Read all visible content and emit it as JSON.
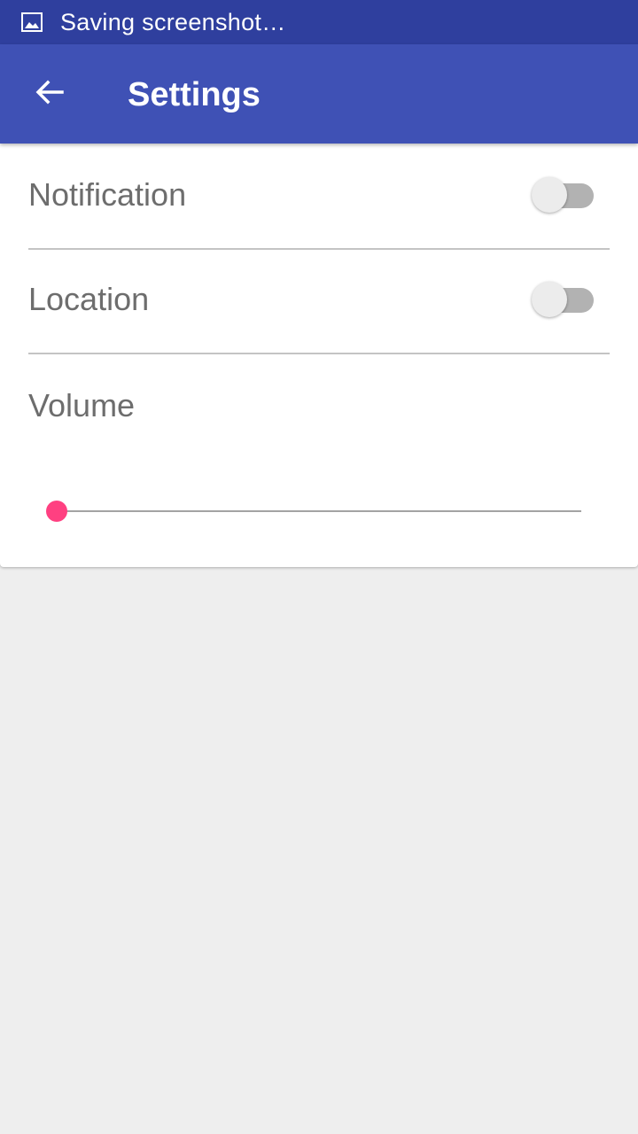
{
  "status_bar": {
    "icon": "image-icon",
    "text": "Saving screenshot…",
    "background": "#2f3f9e"
  },
  "app_bar": {
    "back_icon": "arrow-back-icon",
    "title": "Settings",
    "background": "#3f51b5"
  },
  "settings": {
    "notification": {
      "label": "Notification",
      "enabled": false
    },
    "location": {
      "label": "Location",
      "enabled": false
    },
    "volume": {
      "label": "Volume",
      "value_fraction": 0,
      "accent": "#ff4081"
    }
  },
  "colors": {
    "page_background": "#eeeeee",
    "card_background": "#ffffff",
    "label_text": "#6d6d6d",
    "switch_off_track": "#b2b2b2",
    "switch_off_thumb": "#ececec"
  }
}
